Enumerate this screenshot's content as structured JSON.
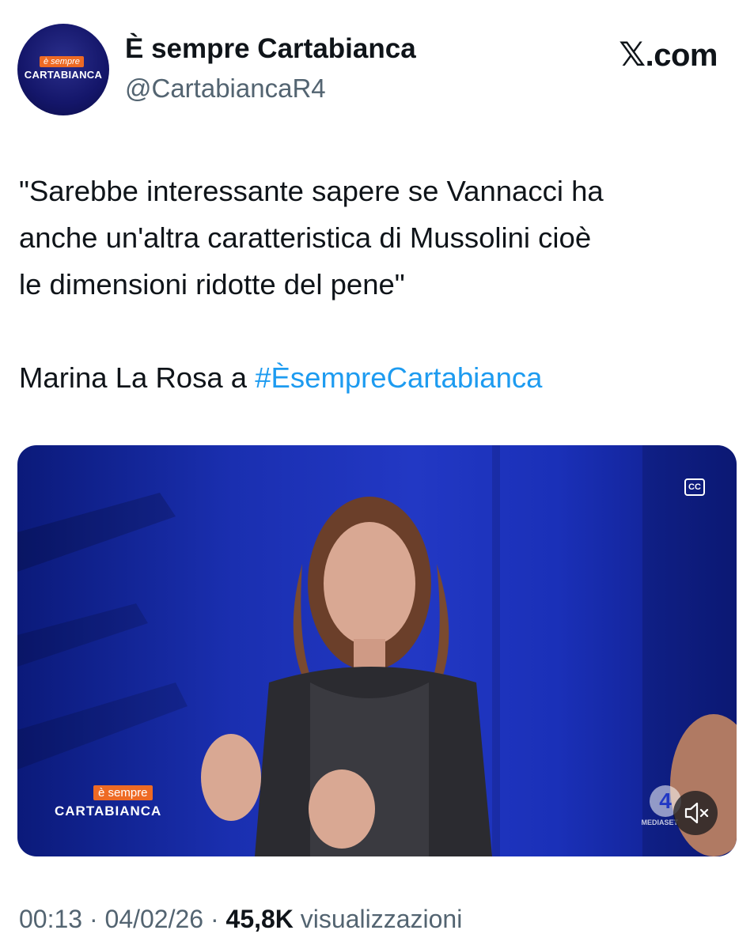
{
  "account": {
    "display_name": "È sempre Cartabianca",
    "handle": "@CartabiancaR4",
    "avatar": {
      "top_text": "è sempre",
      "bottom_text": "CARTABIANCA"
    }
  },
  "brand": {
    "x_glyph": "𝕏",
    "domain": ".com"
  },
  "tweet": {
    "lines": [
      "\"Sarebbe interessante sapere se Vannacci ha",
      "anche un'altra caratteristica di Mussolini cioè",
      "le dimensioni ridotte del pene\""
    ],
    "attribution_prefix": "Marina La Rosa a ",
    "hashtag": "#ÈsempreCartabianca"
  },
  "video": {
    "cc_label": "CC",
    "overlay_logo_top": "è sempre",
    "overlay_logo_bottom": "CARTABIANCA",
    "channel_number": "4",
    "channel_label": "MEDIASET",
    "mute_icon": "speaker-muted-icon"
  },
  "meta": {
    "time": "00:13",
    "separator": " · ",
    "date": "04/02/26",
    "views_count": "45,8K",
    "views_label": " visualizzazioni"
  },
  "colors": {
    "text": "#0f1419",
    "secondary": "#536471",
    "link": "#1d9bf0",
    "accent_orange": "#ee6a24",
    "studio_blue": "#2238c4"
  }
}
